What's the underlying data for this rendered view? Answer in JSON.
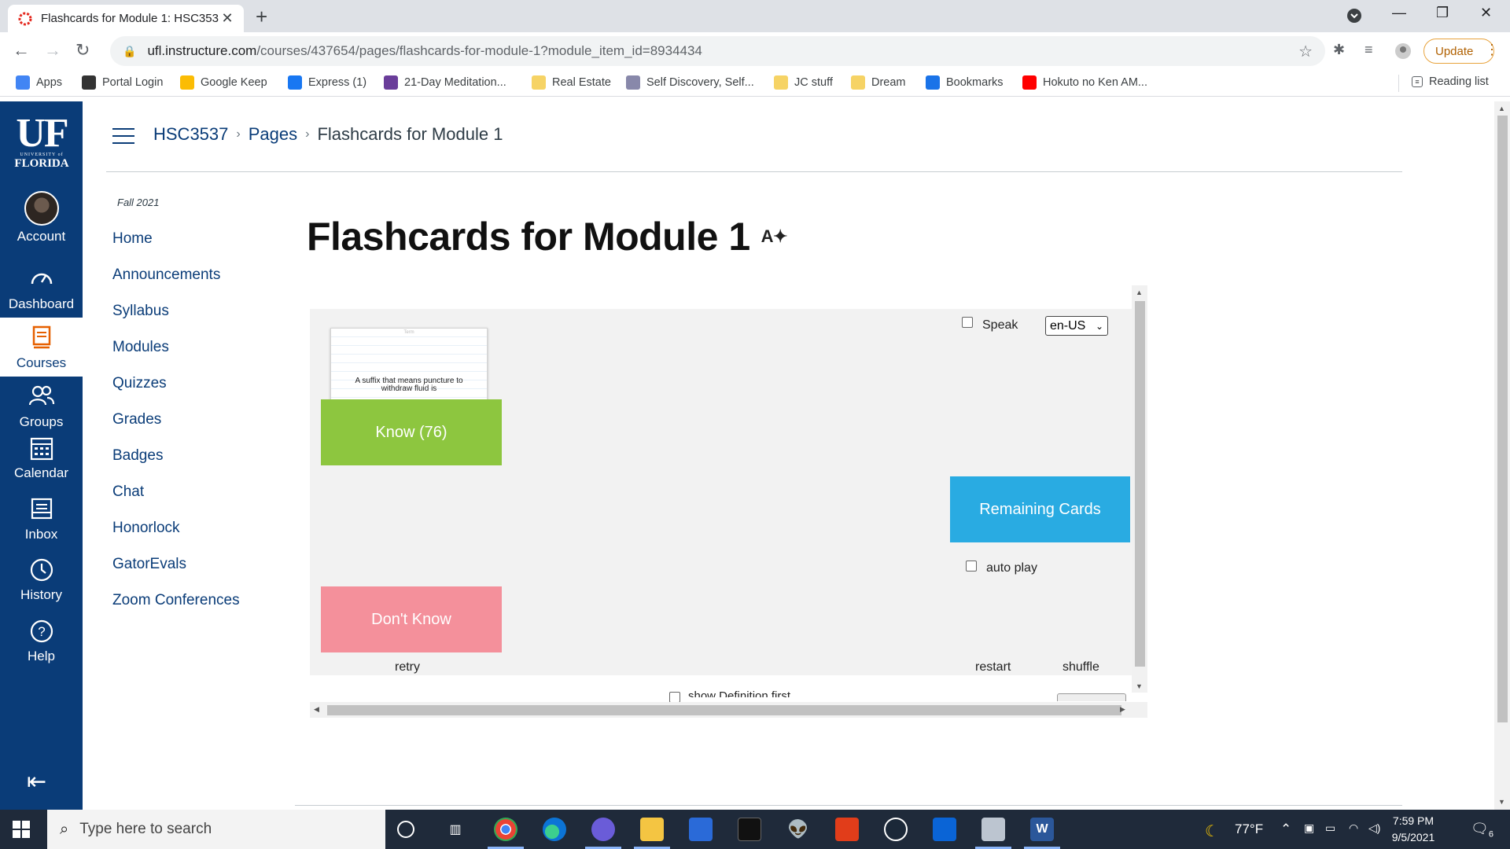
{
  "browser": {
    "tab_title": "Flashcards for Module 1: HSC353",
    "tab_close": "✕",
    "new_tab": "+",
    "url_domain": "ufl.instructure.com",
    "url_path": "/courses/437654/pages/flashcards-for-module-1?module_item_id=8934434",
    "update_label": "Update",
    "bookmarks": [
      {
        "label": "Apps",
        "icon": "apps-grid-icon",
        "color": "#4285f4"
      },
      {
        "label": "Portal Login",
        "icon": "arrow-icon",
        "color": "#333333"
      },
      {
        "label": "Google Keep",
        "icon": "keep-icon",
        "color": "#fbbc04"
      },
      {
        "label": "Express (1)",
        "icon": "facebook-icon",
        "color": "#1877f2"
      },
      {
        "label": "21-Day Meditation...",
        "icon": "meditation-icon",
        "color": "#6a3d9a"
      },
      {
        "label": "Real Estate",
        "icon": "folder-icon",
        "color": "#f6d365"
      },
      {
        "label": "Self Discovery, Self...",
        "icon": "site-icon",
        "color": "#8888aa"
      },
      {
        "label": "JC stuff",
        "icon": "folder-icon",
        "color": "#f6d365"
      },
      {
        "label": "Dream",
        "icon": "folder-icon",
        "color": "#f6d365"
      },
      {
        "label": "Bookmarks",
        "icon": "star-icon",
        "color": "#1a73e8"
      },
      {
        "label": "Hokuto no Ken AM...",
        "icon": "youtube-icon",
        "color": "#ff0000"
      }
    ],
    "reading_list": "Reading list"
  },
  "globalnav": {
    "logo_uf": "UF",
    "logo_university": "UNIVERSITY of",
    "logo_florida": "FLORIDA",
    "items": [
      {
        "label": "Account",
        "icon": "avatar-icon"
      },
      {
        "label": "Dashboard",
        "icon": "dashboard-icon"
      },
      {
        "label": "Courses",
        "icon": "courses-icon"
      },
      {
        "label": "Groups",
        "icon": "groups-icon"
      },
      {
        "label": "Calendar",
        "icon": "calendar-icon"
      },
      {
        "label": "Inbox",
        "icon": "inbox-icon"
      },
      {
        "label": "History",
        "icon": "history-icon"
      },
      {
        "label": "Help",
        "icon": "help-icon"
      }
    ]
  },
  "breadcrumb": {
    "course": "HSC3537",
    "section": "Pages",
    "page": "Flashcards for Module 1",
    "sep": "›"
  },
  "coursenav": {
    "term": "Fall 2021",
    "items": [
      "Home",
      "Announcements",
      "Syllabus",
      "Modules",
      "Quizzes",
      "Grades",
      "Badges",
      "Chat",
      "Honorlock",
      "GatorEvals",
      "Zoom Conferences"
    ]
  },
  "page": {
    "title": "Flashcards for Module 1"
  },
  "flashcards": {
    "card_label": "Term",
    "card_text": "A suffix that means puncture to withdraw fluid is",
    "know_label": "Know (76)",
    "dont_know_label": "Don't Know",
    "remaining_label": "Remaining Cards",
    "speak_label": "Speak",
    "language": "en-US",
    "autoplay_label": "auto play",
    "retry_label": "retry",
    "restart_label": "restart",
    "shuffle_label": "shuffle",
    "definition_first_label": "show Definition first",
    "colors": {
      "know": "#8dc63f",
      "dont_know": "#f4909b",
      "remaining": "#29abe2"
    }
  },
  "taskbar": {
    "search_placeholder": "Type here to search",
    "weather": "77°F",
    "time": "7:59 PM",
    "date": "9/5/2021",
    "notifications": "6"
  }
}
